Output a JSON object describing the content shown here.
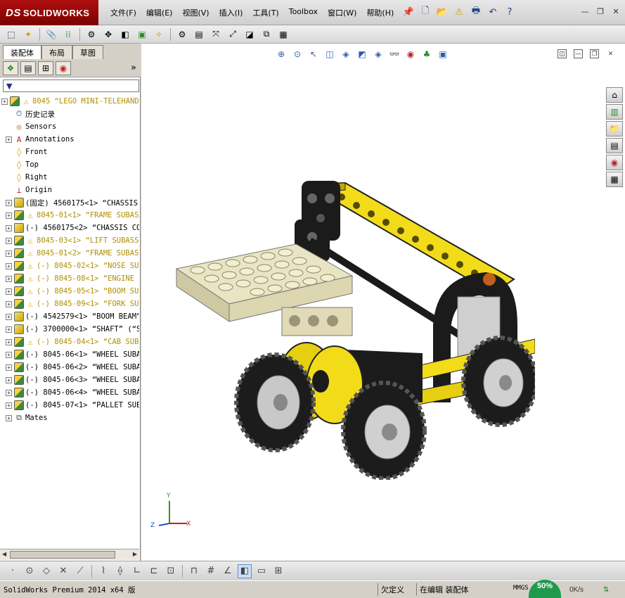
{
  "app": {
    "logo_text": "SOLIDWORKS",
    "logo_mark": "DS"
  },
  "menu": [
    {
      "label": "文件(F)"
    },
    {
      "label": "编辑(E)"
    },
    {
      "label": "视图(V)"
    },
    {
      "label": "插入(I)"
    },
    {
      "label": "工具(T)"
    },
    {
      "label": "Toolbox"
    },
    {
      "label": "窗口(W)"
    },
    {
      "label": "帮助(H)"
    }
  ],
  "tabs": [
    {
      "label": "装配体",
      "active": true
    },
    {
      "label": "布局",
      "active": false
    },
    {
      "label": "草图",
      "active": false
    }
  ],
  "tree": [
    {
      "level": 0,
      "exp": "+",
      "icon": "asm",
      "warn": true,
      "label": "8045 “LEGO MINI-TELEHANDLE",
      "warn_text": true
    },
    {
      "level": 1,
      "exp": "",
      "icon": "history",
      "warn": false,
      "label": "历史记录",
      "warn_text": false
    },
    {
      "level": 1,
      "exp": "",
      "icon": "sensor",
      "warn": false,
      "label": "Sensors",
      "warn_text": false
    },
    {
      "level": 1,
      "exp": "+",
      "icon": "annot",
      "warn": false,
      "label": "Annotations",
      "warn_text": false
    },
    {
      "level": 1,
      "exp": "",
      "icon": "plane",
      "warn": false,
      "label": "Front",
      "warn_text": false
    },
    {
      "level": 1,
      "exp": "",
      "icon": "plane",
      "warn": false,
      "label": "Top",
      "warn_text": false
    },
    {
      "level": 1,
      "exp": "",
      "icon": "plane",
      "warn": false,
      "label": "Right",
      "warn_text": false
    },
    {
      "level": 1,
      "exp": "",
      "icon": "origin",
      "warn": false,
      "label": "Origin",
      "warn_text": false
    },
    {
      "level": 1,
      "exp": "+",
      "icon": "part",
      "warn": false,
      "label": "(固定) 4560175<1> “CHASSIS",
      "warn_text": false
    },
    {
      "level": 1,
      "exp": "+",
      "icon": "asm",
      "warn": true,
      "label": "8045-01<1> “FRAME SUBAS",
      "warn_text": true
    },
    {
      "level": 1,
      "exp": "+",
      "icon": "part",
      "warn": false,
      "label": "(-) 4560175<2> “CHASSIS CO",
      "warn_text": false
    },
    {
      "level": 1,
      "exp": "+",
      "icon": "asm",
      "warn": true,
      "label": "8045-03<1> “LIFT SUBASS",
      "warn_text": true
    },
    {
      "level": 1,
      "exp": "+",
      "icon": "asm",
      "warn": true,
      "label": "8045-01<2> “FRAME SUBAS",
      "warn_text": true
    },
    {
      "level": 1,
      "exp": "+",
      "icon": "asm",
      "warn": true,
      "label": "(-) 8045-02<1> “NOSE SU",
      "warn_text": true
    },
    {
      "level": 1,
      "exp": "+",
      "icon": "asm",
      "warn": true,
      "label": "(-) 8045-08<1> “ENGINE",
      "warn_text": true
    },
    {
      "level": 1,
      "exp": "+",
      "icon": "asm",
      "warn": true,
      "label": "(-) 8045-05<1> “BOOM SU",
      "warn_text": true
    },
    {
      "level": 1,
      "exp": "+",
      "icon": "asm",
      "warn": true,
      "label": "(-) 8045-09<1> “FORK SU",
      "warn_text": true
    },
    {
      "level": 1,
      "exp": "+",
      "icon": "part",
      "warn": false,
      "label": "(-) 4542579<1> “BOOM BEAM”",
      "warn_text": false
    },
    {
      "level": 1,
      "exp": "+",
      "icon": "part",
      "warn": false,
      "label": "(-) 3700000<1> “SHAFT” (“S",
      "warn_text": false
    },
    {
      "level": 1,
      "exp": "+",
      "icon": "asm",
      "warn": true,
      "label": "(-) 8045-04<1> “CAB SUB",
      "warn_text": true
    },
    {
      "level": 1,
      "exp": "+",
      "icon": "asm",
      "warn": false,
      "label": "(-) 8045-06<1> “WHEEL SUBA",
      "warn_text": false
    },
    {
      "level": 1,
      "exp": "+",
      "icon": "asm",
      "warn": false,
      "label": "(-) 8045-06<2> “WHEEL SUBA",
      "warn_text": false
    },
    {
      "level": 1,
      "exp": "+",
      "icon": "asm",
      "warn": false,
      "label": "(-) 8045-06<3> “WHEEL SUBA",
      "warn_text": false
    },
    {
      "level": 1,
      "exp": "+",
      "icon": "asm",
      "warn": false,
      "label": "(-) 8045-06<4> “WHEEL SUBA",
      "warn_text": false
    },
    {
      "level": 1,
      "exp": "+",
      "icon": "asm",
      "warn": false,
      "label": "(-) 8045-07<1> “PALLET SUE",
      "warn_text": false
    },
    {
      "level": 1,
      "exp": "+",
      "icon": "mates",
      "warn": false,
      "label": "Mates",
      "warn_text": false
    }
  ],
  "triad": {
    "x": "X",
    "y": "Y",
    "z": "Z"
  },
  "status": {
    "product": "SolidWorks Premium 2014 x64 版",
    "state": "欠定义",
    "mode": "在编辑 装配体",
    "units": "MMGS",
    "net_percent": "50%",
    "net_speed": "0K/s"
  },
  "colors": {
    "accent_red": "#9a0c0c",
    "lego_yellow": "#f2dc1a",
    "lego_black": "#1b1b1b",
    "lego_tan": "#e9e4c2",
    "warn_text": "#b09000"
  }
}
